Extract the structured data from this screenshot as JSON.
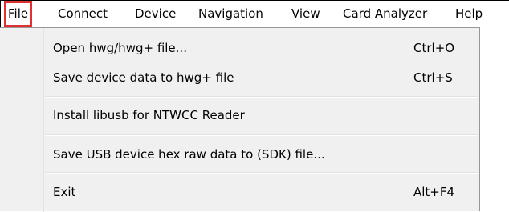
{
  "menubar": {
    "items": [
      {
        "label": "File"
      },
      {
        "label": "Connect"
      },
      {
        "label": "Device"
      },
      {
        "label": "Navigation"
      },
      {
        "label": "View"
      },
      {
        "label": "Card Analyzer"
      },
      {
        "label": "Help"
      }
    ]
  },
  "file_menu": {
    "open": {
      "label": "Open hwg/hwg+ file...",
      "shortcut": "Ctrl+O"
    },
    "save": {
      "label": "Save device data to hwg+ file",
      "shortcut": "Ctrl+S"
    },
    "install": {
      "label": "Install libusb for NTWCC Reader"
    },
    "save_usb": {
      "label": "Save USB device hex raw data to (SDK) file..."
    },
    "exit": {
      "label": "Exit",
      "shortcut": "Alt+F4"
    }
  },
  "colors": {
    "highlight_border": "#e03030",
    "menu_background": "#f0f0f0",
    "menubar_background": "#ffffff"
  }
}
